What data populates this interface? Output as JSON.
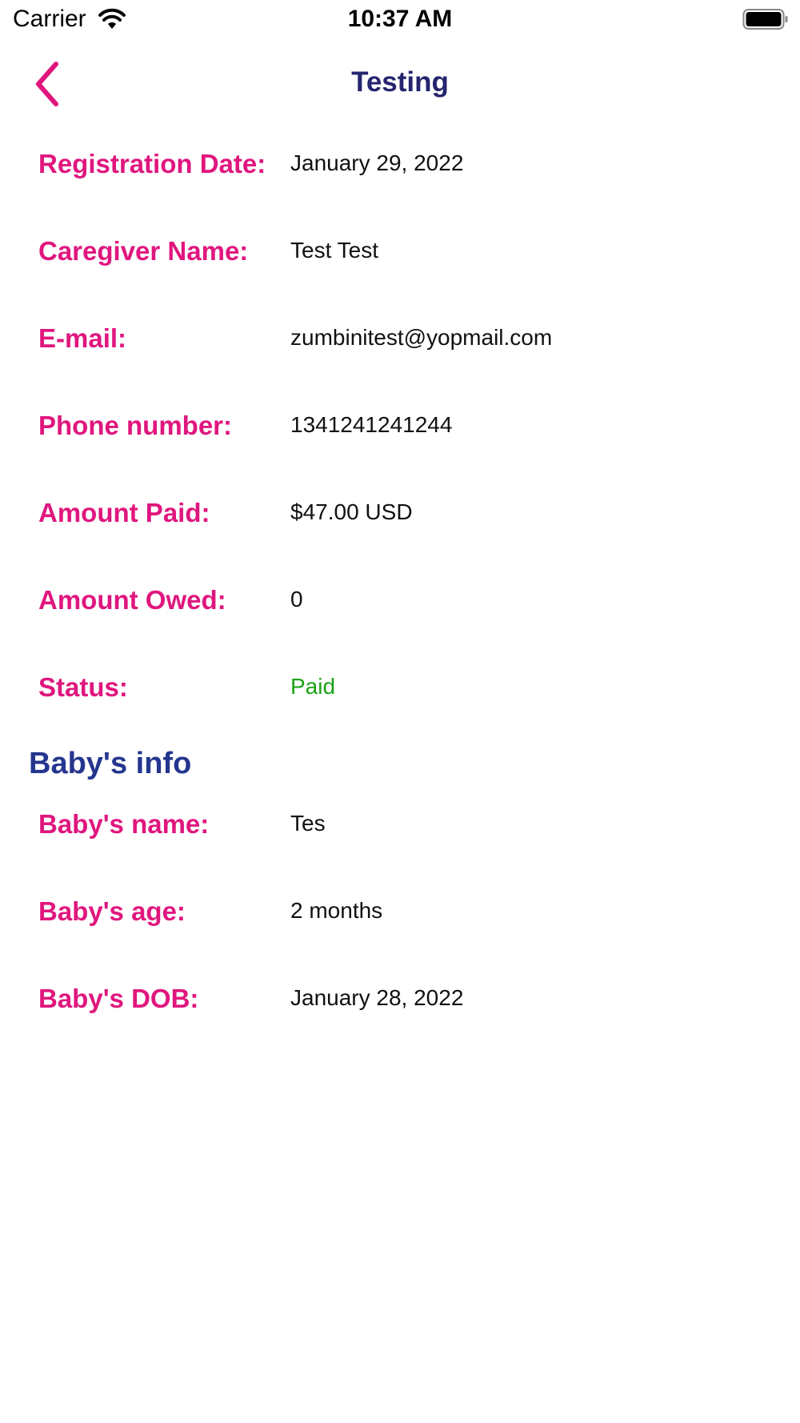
{
  "status_bar": {
    "carrier": "Carrier",
    "time": "10:37 AM",
    "wifi_icon": "wifi-icon",
    "battery_icon": "battery-icon"
  },
  "nav": {
    "title": "Testing",
    "back_icon": "chevron-left-icon"
  },
  "details": [
    {
      "label": "Registration Date:",
      "value": "January 29, 2022"
    },
    {
      "label": "Caregiver Name:",
      "value": "Test Test"
    },
    {
      "label": "E-mail:",
      "value": "zumbinitest@yopmail.com"
    },
    {
      "label": "Phone number:",
      "value": "1341241241244"
    },
    {
      "label": "Amount Paid:",
      "value": "$47.00 USD"
    },
    {
      "label": "Amount Owed:",
      "value": "0"
    },
    {
      "label": "Status:",
      "value": "Paid"
    }
  ],
  "baby_section": {
    "title": "Baby's info",
    "items": [
      {
        "label": "Baby's name:",
        "value": "Tes"
      },
      {
        "label": "Baby's age:",
        "value": "2 months"
      },
      {
        "label": "Baby's DOB:",
        "value": "January 28, 2022"
      }
    ]
  },
  "colors": {
    "label": "#e0167e",
    "title": "#25246f",
    "section": "#25368f",
    "status_paid": "#1aa316",
    "value": "#111111"
  }
}
